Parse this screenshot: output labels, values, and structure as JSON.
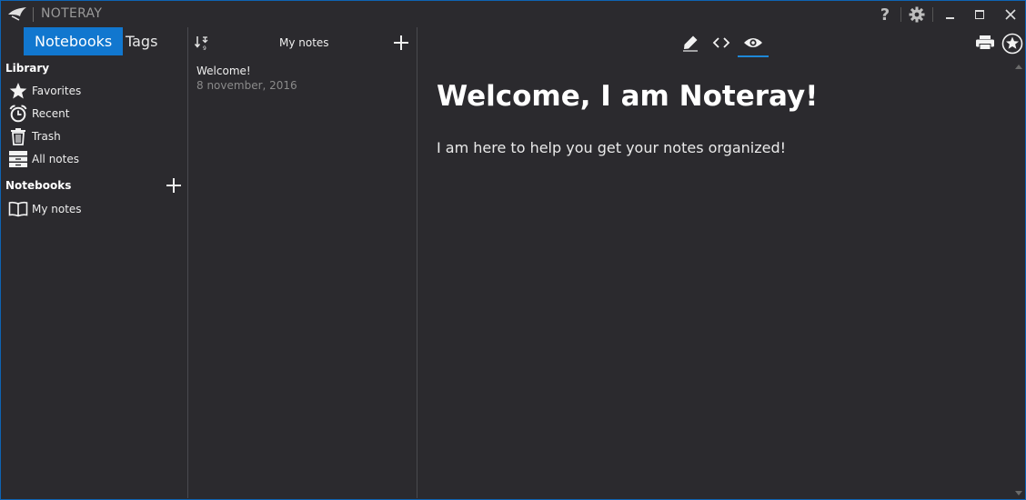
{
  "window": {
    "app_title": "NOTERAY",
    "icons": [
      "logo-icon",
      "help-icon",
      "settings-icon",
      "minimize-icon",
      "maximize-icon",
      "close-icon"
    ]
  },
  "sidebar": {
    "tabs": [
      {
        "label": "Notebooks",
        "active": true
      },
      {
        "label": "Tags",
        "active": false
      }
    ],
    "library_heading": "Library",
    "library_items": [
      {
        "label": "Favorites",
        "icon": "star-icon"
      },
      {
        "label": "Recent",
        "icon": "alarm-clock-icon"
      },
      {
        "label": "Trash",
        "icon": "trash-icon"
      },
      {
        "label": "All notes",
        "icon": "archive-icon"
      }
    ],
    "notebooks_heading": "Notebooks",
    "notebooks": [
      {
        "label": "My notes",
        "icon": "book-icon"
      }
    ]
  },
  "note_list": {
    "title": "My notes",
    "notes": [
      {
        "title": "Welcome!",
        "date": "8 november, 2016"
      }
    ]
  },
  "editor": {
    "modes": [
      "edit-icon",
      "code-icon",
      "preview-icon"
    ],
    "active_mode": "preview",
    "heading": "Welcome, I am Noteray!",
    "body": "I am here to help you get your notes organized!"
  },
  "colors": {
    "accent": "#1177cf",
    "background": "#2b2a2e"
  }
}
